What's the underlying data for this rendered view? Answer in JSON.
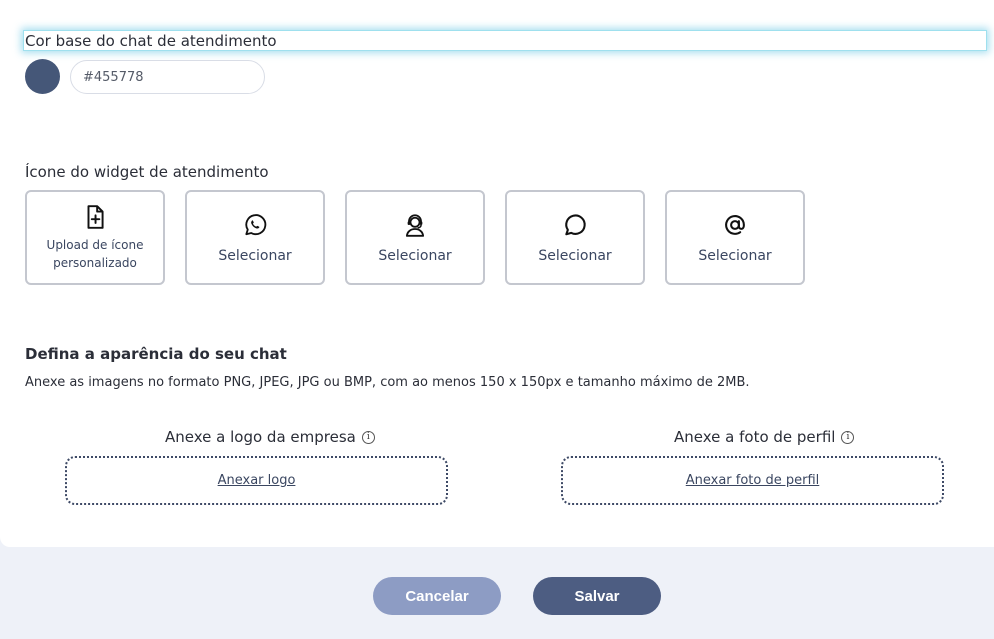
{
  "base_color": {
    "title": "Cor base do chat de atendimento",
    "value": "#455778",
    "swatch_color": "#455778"
  },
  "widget_icon": {
    "title": "Ícone do widget de atendimento",
    "options": [
      {
        "icon": "file-plus-icon",
        "label_line1": "Upload de ícone",
        "label_line2": "personalizado"
      },
      {
        "icon": "whatsapp-icon",
        "label": "Selecionar"
      },
      {
        "icon": "headset-agent-icon",
        "label": "Selecionar"
      },
      {
        "icon": "chat-bubble-icon",
        "label": "Selecionar"
      },
      {
        "icon": "at-sign-icon",
        "label": "Selecionar"
      }
    ]
  },
  "appearance": {
    "title": "Defina a aparência do seu chat",
    "hint": "Anexe as imagens no formato PNG, JPEG, JPG ou BMP, com ao menos 150 x 150px e tamanho máximo de 2MB.",
    "logo": {
      "label": "Anexe a logo da empresa",
      "link": "Anexar logo"
    },
    "profile": {
      "label": "Anexe a foto de perfil",
      "link": "Anexar foto de perfil"
    }
  },
  "actions": {
    "cancel": "Cancelar",
    "save": "Salvar"
  },
  "colors": {
    "primary": "#4d5d82",
    "cancel": "#8d9cc4",
    "page_bg": "#eef1f8"
  }
}
